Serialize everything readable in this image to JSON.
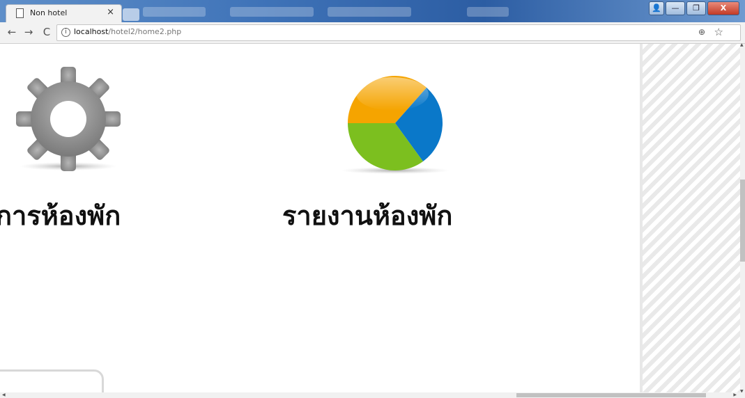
{
  "browser": {
    "tab_title": "Non hotel",
    "tab_close": "×",
    "url_host": "localhost",
    "url_path": "/hotel2/home2.php",
    "window_controls": {
      "user": "👤",
      "minimize": "—",
      "maximize": "❐",
      "close": "X"
    }
  },
  "icons": {
    "back": "←",
    "forward": "→",
    "reload": "C",
    "info": "i",
    "zoom": "⊕",
    "star": "☆",
    "menu": "⋮"
  },
  "page": {
    "tiles": [
      {
        "label": "การห้องพัก",
        "icon": "gear-icon"
      },
      {
        "label": "รายงานห้องพัก",
        "icon": "pie-chart-icon"
      }
    ]
  },
  "colors": {
    "pie_orange": "#f5a400",
    "pie_blue": "#0a78c9",
    "pie_green": "#7cbf1f",
    "gear": "#8a8a8a"
  }
}
